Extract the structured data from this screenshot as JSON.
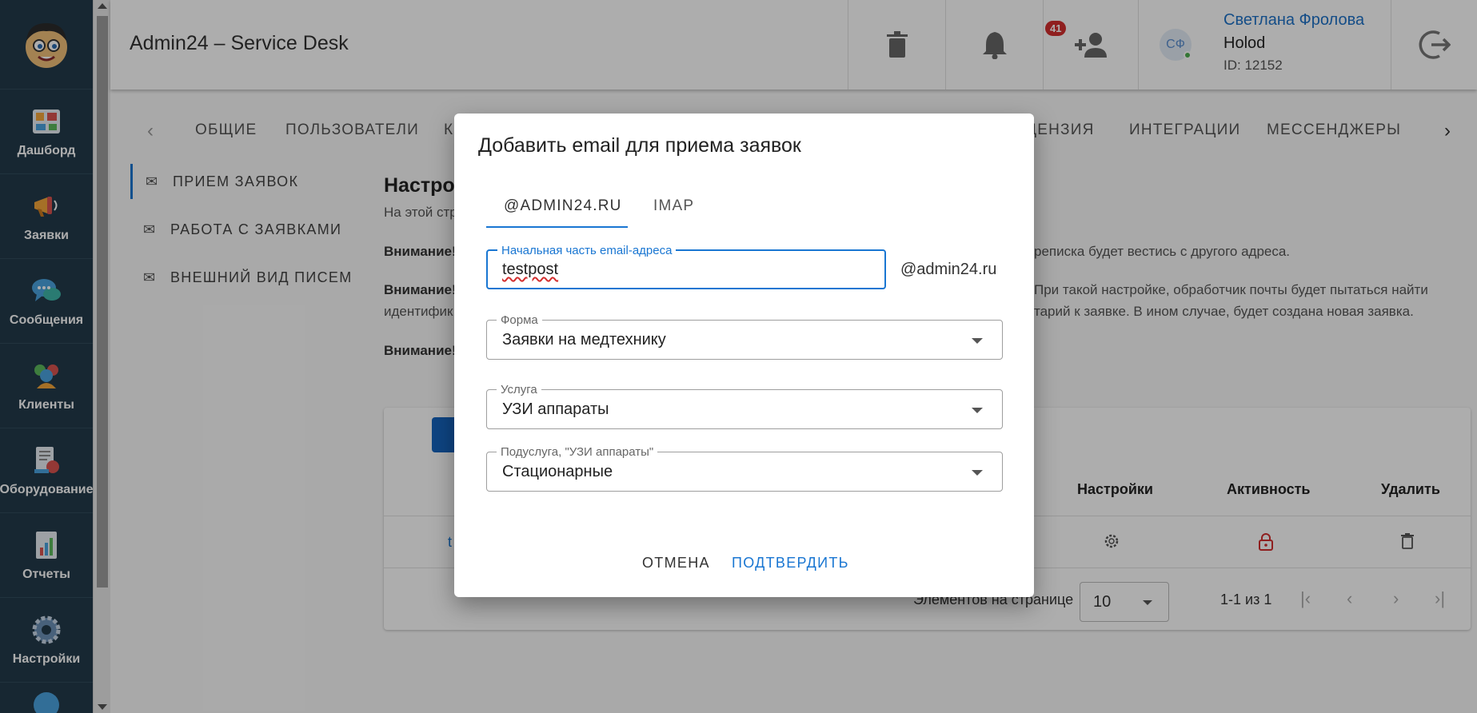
{
  "header": {
    "app_title": "Admin24 – Service Desk",
    "notifications_count": "41",
    "user": {
      "initials": "СФ",
      "name": "Светлана Фролова",
      "company": "Holod",
      "id": "ID: 12152"
    }
  },
  "sidebar": {
    "items": [
      {
        "label": "Дашборд",
        "icon": "dashboard-icon"
      },
      {
        "label": "Заявки",
        "icon": "megaphone-icon"
      },
      {
        "label": "Сообщения",
        "icon": "chat-icon"
      },
      {
        "label": "Клиенты",
        "icon": "clients-icon"
      },
      {
        "label": "Оборудование",
        "icon": "equipment-icon"
      },
      {
        "label": "Отчеты",
        "icon": "reports-icon"
      },
      {
        "label": "Настройки",
        "icon": "gear-icon"
      }
    ]
  },
  "tabs": [
    "ОБЩИЕ",
    "ПОЛЬЗОВАТЕЛИ",
    "К",
    "ЦЕНЗИЯ",
    "ИНТЕГРАЦИИ",
    "МЕССЕНДЖЕРЫ"
  ],
  "subnav": [
    "ПРИЕМ ЗАЯВОК",
    "РАБОТА С ЗАЯВКАМИ",
    "ВНЕШНИЙ ВИД ПИСЕМ"
  ],
  "content": {
    "title": "Настро",
    "intro": "На этой стр",
    "warning1_label": "Внимание!",
    "warning1_tail": "реписка будет вестись с другого адреса.",
    "warning2_label": "Внимание!",
    "warning2_tail": "При такой настройке, обработчик почты будет пытаться найти",
    "warning2_line2_start": "идентифик",
    "warning2_line2_tail": "тарий к заявке. В ином случае, будет создана новая заявка.",
    "warning3_label": "Внимание!"
  },
  "table": {
    "headers": {
      "settings": "Настройки",
      "active": "Активность",
      "delete": "Удалить"
    },
    "row_fragment": "t",
    "pager": {
      "label": "Элементов на странице",
      "per_page": "10",
      "range": "1-1 из 1"
    }
  },
  "dialog": {
    "title": "Добавить email для приема заявок",
    "tabs": [
      "@ADMIN24.RU",
      "IMAP"
    ],
    "email_label": "Начальная часть email-адреса",
    "email_value": "testpost",
    "email_suffix": "@admin24.ru",
    "form_label": "Форма",
    "form_value": "Заявки на медтехнику",
    "service_label": "Услуга",
    "service_value": "УЗИ аппараты",
    "subservice_label": "Подуслуга, \"УЗИ аппараты\"",
    "subservice_value": "Стационарные",
    "cancel": "ОТМЕНА",
    "confirm": "ПОДТВЕРДИТЬ"
  },
  "colors": {
    "sidebar_bg": "#223a4a",
    "accent": "#1976d2",
    "danger": "#d32f2f"
  }
}
